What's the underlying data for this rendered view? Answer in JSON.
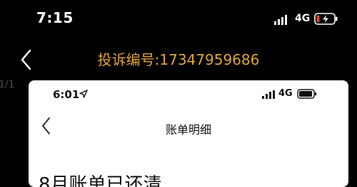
{
  "outer": {
    "status_bar": {
      "time": "7:15",
      "network": "4G",
      "battery_icon": "battery-low-charging-icon",
      "signal_icon": "signal-bars-icon"
    },
    "nav": {
      "back_icon": "chevron-left-icon",
      "title": "投诉编号:17347959686"
    },
    "side_pager": "1/1"
  },
  "inner": {
    "status_bar": {
      "time": "6:01",
      "location_icon": "location-arrow-icon",
      "network": "4G",
      "battery_icon": "battery-icon",
      "signal_icon": "signal-bars-icon"
    },
    "nav": {
      "back_icon": "chevron-left-icon",
      "title": "账单明细"
    },
    "partial_text": "8月账单已还清"
  },
  "colors": {
    "outer_bg": "#000000",
    "title_accent": "#e0a33a",
    "card_bg": "#ffffff",
    "battery_low": "#e0463c"
  }
}
